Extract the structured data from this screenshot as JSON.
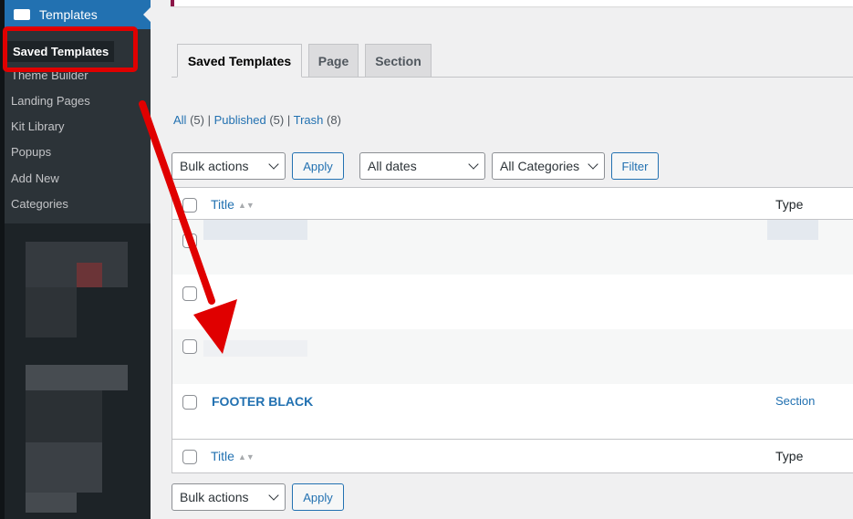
{
  "sidebar": {
    "menu_title": "Templates",
    "items": [
      "Saved Templates",
      "Theme Builder",
      "Landing Pages",
      "Kit Library",
      "Popups",
      "Add New",
      "Categories"
    ],
    "accent": "#2271b1",
    "highlight_color": "#e00000"
  },
  "tabs": [
    "Saved Templates",
    "Page",
    "Section"
  ],
  "views": {
    "all": "All",
    "all_count": "(5)",
    "published": "Published",
    "published_count": "(5)",
    "trash": "Trash",
    "trash_count": "(8)",
    "sep": "|"
  },
  "filters": {
    "bulk_actions": "Bulk actions",
    "apply": "Apply",
    "dates": "All dates",
    "categories": "All Categories",
    "filter": "Filter"
  },
  "table": {
    "col_title": "Title",
    "col_type": "Type",
    "rows": [
      {
        "title": "",
        "type": ""
      },
      {
        "title": "",
        "type": ""
      },
      {
        "title": "",
        "type": ""
      },
      {
        "title": "FOOTER BLACK",
        "type": "Section"
      }
    ]
  }
}
